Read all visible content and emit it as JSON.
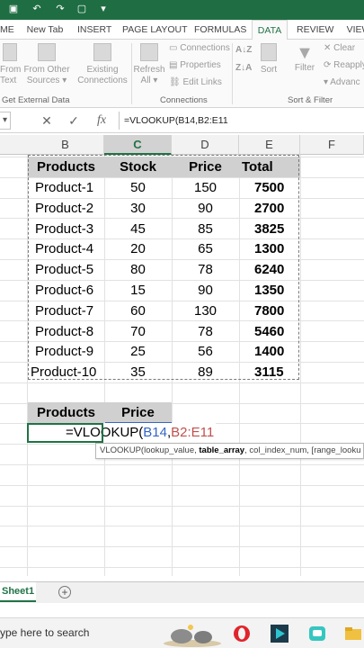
{
  "quick_access": {
    "icons": [
      "save-icon",
      "undo-icon",
      "redo-icon",
      "blank-icon",
      "more-icon"
    ]
  },
  "ribbon_tabs": [
    "ME",
    "New Tab",
    "INSERT",
    "PAGE LAYOUT",
    "FORMULAS",
    "DATA",
    "REVIEW",
    "VIEW"
  ],
  "active_tab": "DATA",
  "ribbon": {
    "from_text": "From\nText",
    "from_other": "From Other\nSources ▾",
    "existing_connections": "Existing\nConnections",
    "refresh_all": "Refresh\nAll ▾",
    "connections": "Connections",
    "properties": "Properties",
    "edit_links": "Edit Links",
    "sort": "Sort",
    "filter": "Filter",
    "clear": "Clear",
    "reapply": "Reapply",
    "advanced": "Advanc",
    "group_get_external": "Get External Data",
    "group_connections": "Connections",
    "group_sort_filter": "Sort & Filter"
  },
  "formula_bar": {
    "name_box": "▾",
    "cancel": "✕",
    "enter": "✓",
    "fx": "fx",
    "formula": "=VLOOKUP(B14,B2:E11"
  },
  "columns": [
    "B",
    "C",
    "D",
    "E",
    "F"
  ],
  "table": {
    "headers": [
      "Products",
      "Stock",
      "Price",
      "Total"
    ],
    "rows": [
      [
        "Product-1",
        "50",
        "150",
        "7500"
      ],
      [
        "Product-2",
        "30",
        "90",
        "2700"
      ],
      [
        "Product-3",
        "45",
        "85",
        "3825"
      ],
      [
        "Product-4",
        "20",
        "65",
        "1300"
      ],
      [
        "Product-5",
        "80",
        "78",
        "6240"
      ],
      [
        "Product-6",
        "15",
        "90",
        "1350"
      ],
      [
        "Product-7",
        "60",
        "130",
        "7800"
      ],
      [
        "Product-8",
        "70",
        "78",
        "5460"
      ],
      [
        "Product-9",
        "25",
        "56",
        "1400"
      ],
      [
        "Product-10",
        "35",
        "89",
        "3115"
      ]
    ]
  },
  "lookup": {
    "headers": [
      "Products",
      "Price"
    ],
    "edit_prefix": "=VLOOKUP(",
    "edit_ref1": "B14",
    "edit_comma": ",",
    "edit_ref2": "B2:E11"
  },
  "tooltip": {
    "fn": "VLOOKUP(",
    "arg1": "lookup_value, ",
    "arg2": "table_array",
    "rest": ", col_index_num, [range_looku"
  },
  "sheet": {
    "tab": "Sheet1",
    "add": "+"
  },
  "taskbar": {
    "search_text": "ype here to search"
  },
  "colors": {
    "excel_green": "#217346",
    "ref_blue": "#3565c5",
    "ref_red": "#c0504d"
  }
}
